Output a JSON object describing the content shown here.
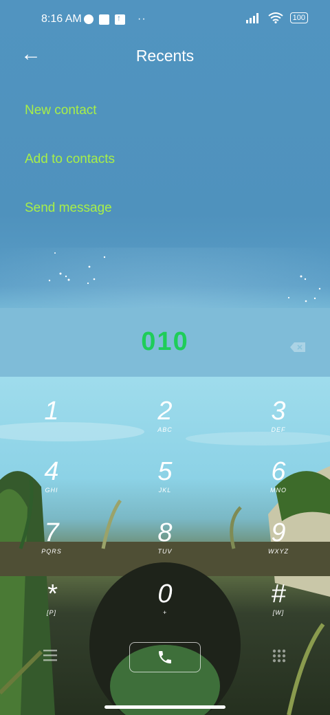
{
  "status_bar": {
    "time": "8:16 AM",
    "battery": "100",
    "overflow_dots": "··"
  },
  "app_bar": {
    "title": "Recents"
  },
  "menu": {
    "new_contact": "New contact",
    "add_to_contacts": "Add to contacts",
    "send_message": "Send message"
  },
  "dial": {
    "number": "010"
  },
  "keys": [
    {
      "digit": "1",
      "letters": ""
    },
    {
      "digit": "2",
      "letters": "ABC"
    },
    {
      "digit": "3",
      "letters": "DEF"
    },
    {
      "digit": "4",
      "letters": "GHI"
    },
    {
      "digit": "5",
      "letters": "JKL"
    },
    {
      "digit": "6",
      "letters": "MNO"
    },
    {
      "digit": "7",
      "letters": "PQRS"
    },
    {
      "digit": "8",
      "letters": "TUV"
    },
    {
      "digit": "9",
      "letters": "WXYZ"
    },
    {
      "digit": "*",
      "letters": "[P]"
    },
    {
      "digit": "0",
      "letters": "+"
    },
    {
      "digit": "#",
      "letters": "[W]"
    }
  ],
  "colors": {
    "menu_text": "#a8ef48",
    "number_text": "#1fcd59"
  }
}
